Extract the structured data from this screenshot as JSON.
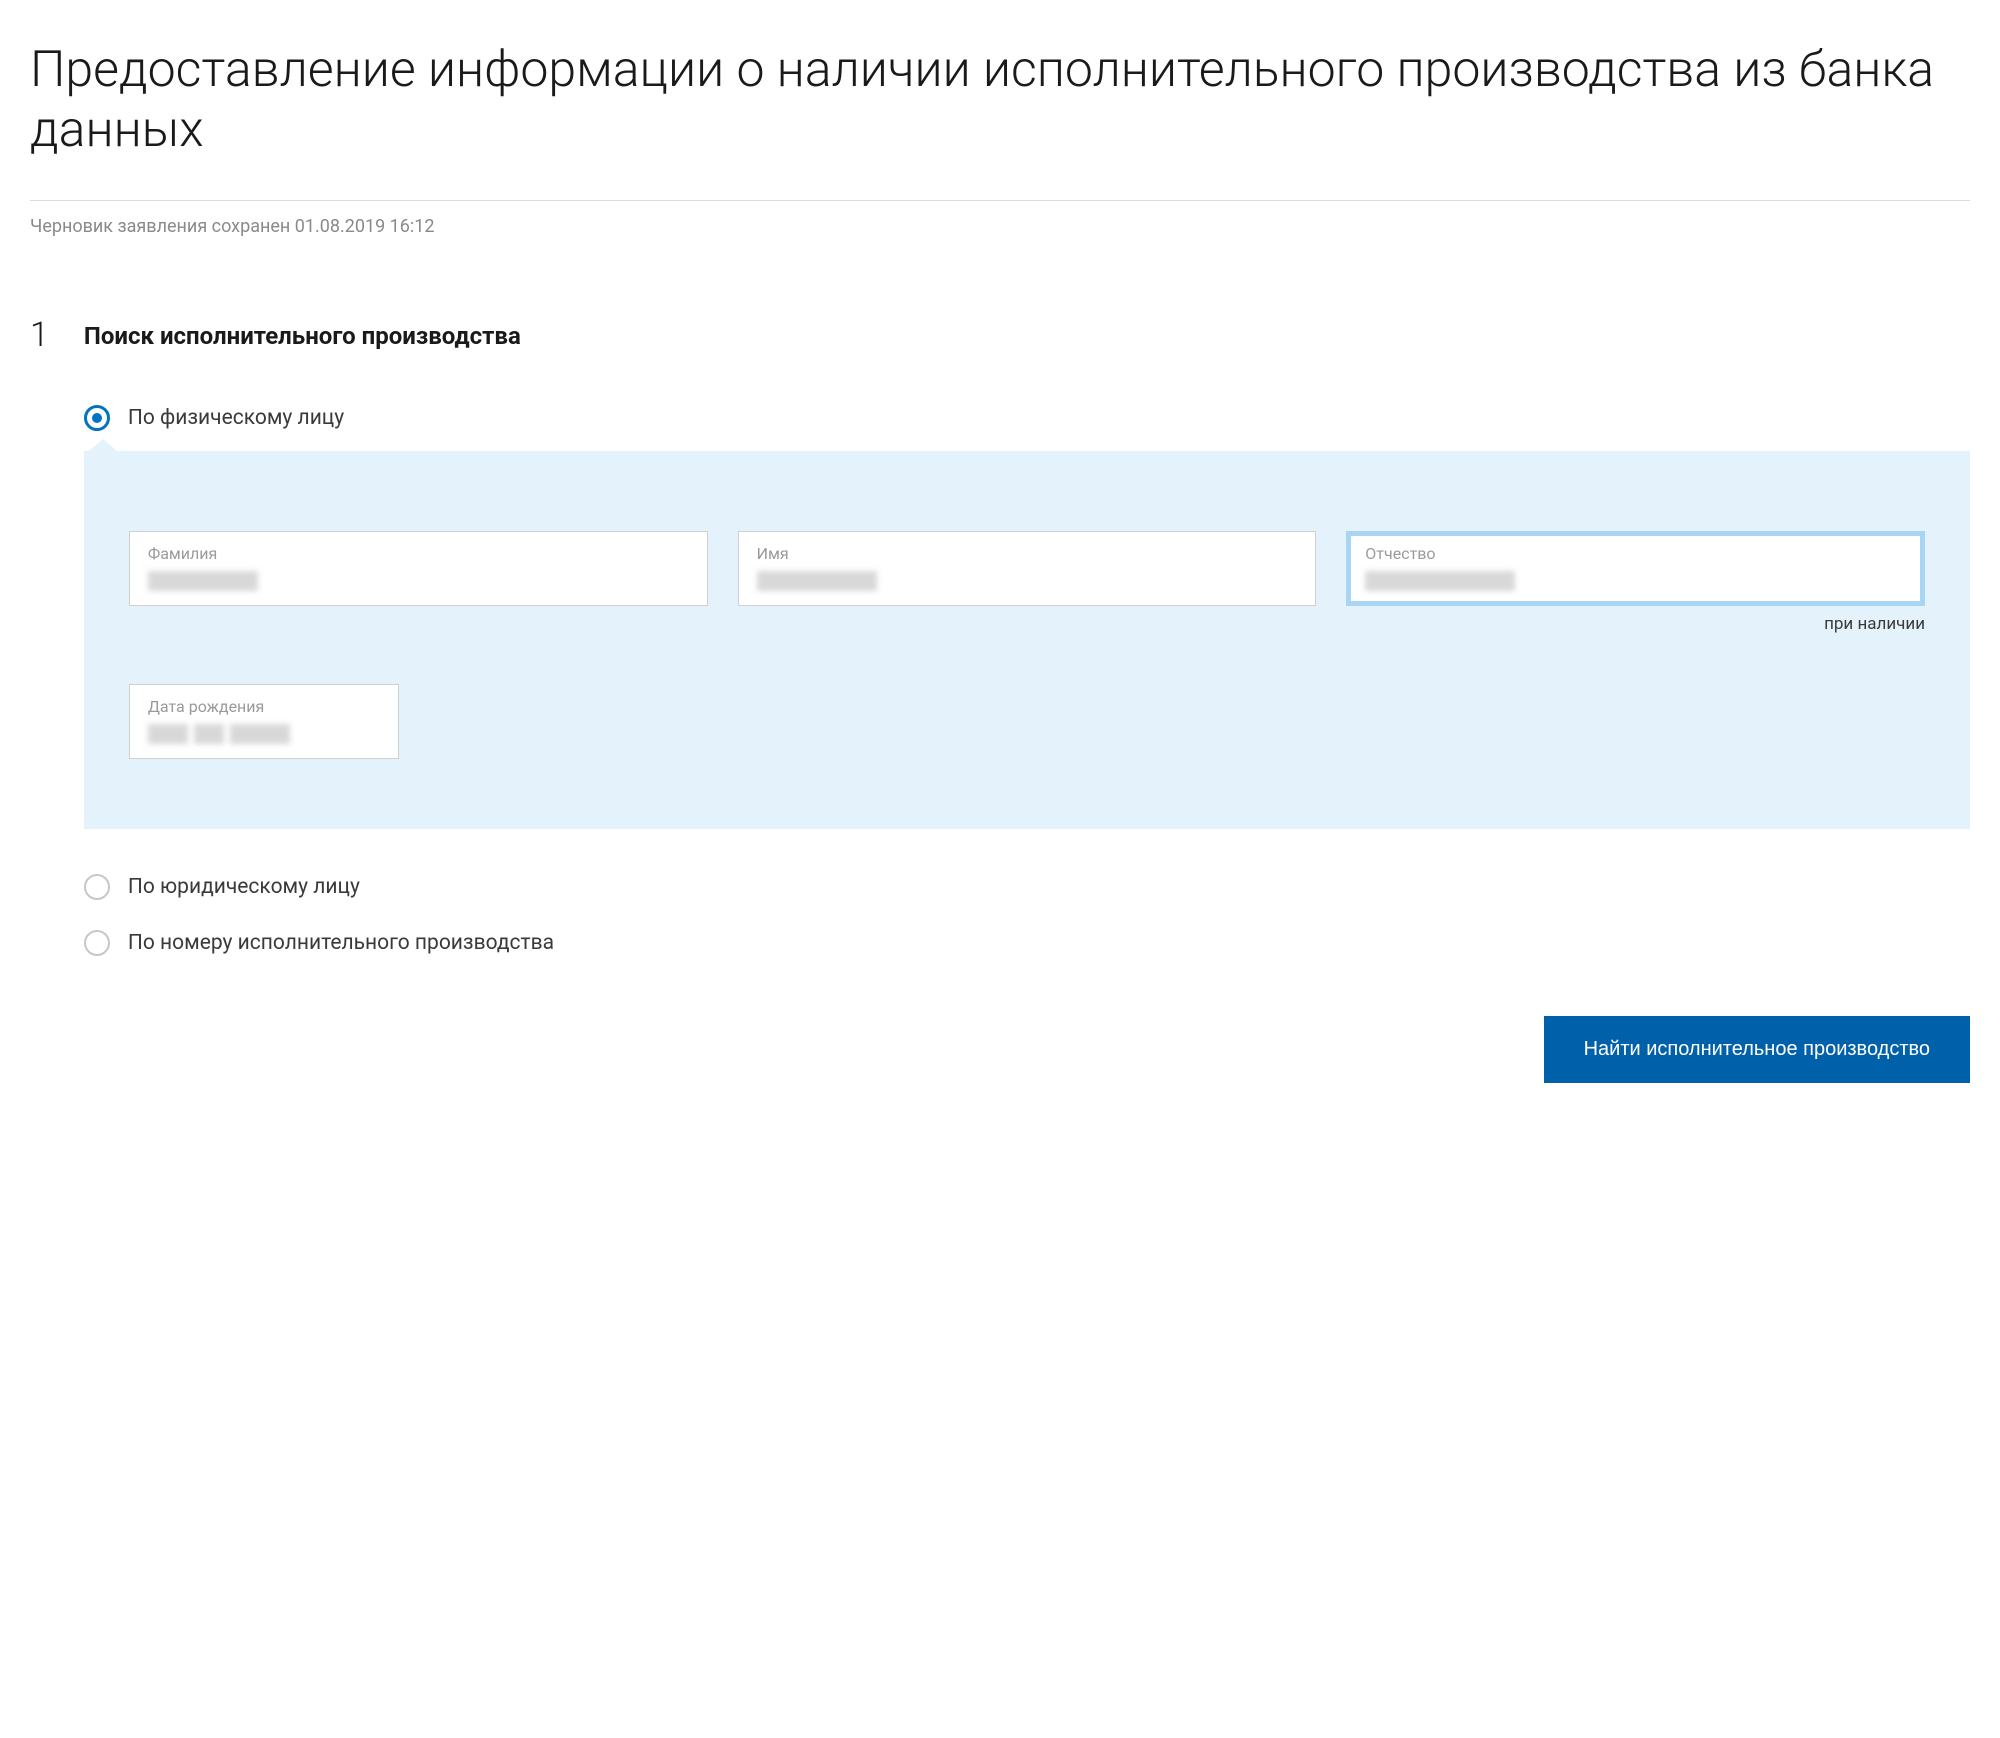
{
  "page": {
    "title": "Предоставление информации о наличии исполнительного производства из банка данных",
    "draft_status": "Черновик заявления сохранен 01.08.2019 16:12"
  },
  "step": {
    "number": "1",
    "title": "Поиск исполнительного производства"
  },
  "radio_options": {
    "individual": "По физическому лицу",
    "legal_entity": "По юридическому лицу",
    "case_number": "По номеру исполнительного производства"
  },
  "form": {
    "surname": {
      "label": "Фамилия"
    },
    "name": {
      "label": "Имя"
    },
    "patronymic": {
      "label": "Отчество",
      "hint": "при наличии"
    },
    "birthdate": {
      "label": "Дата рождения"
    }
  },
  "submit_button": "Найти исполнительное производство"
}
